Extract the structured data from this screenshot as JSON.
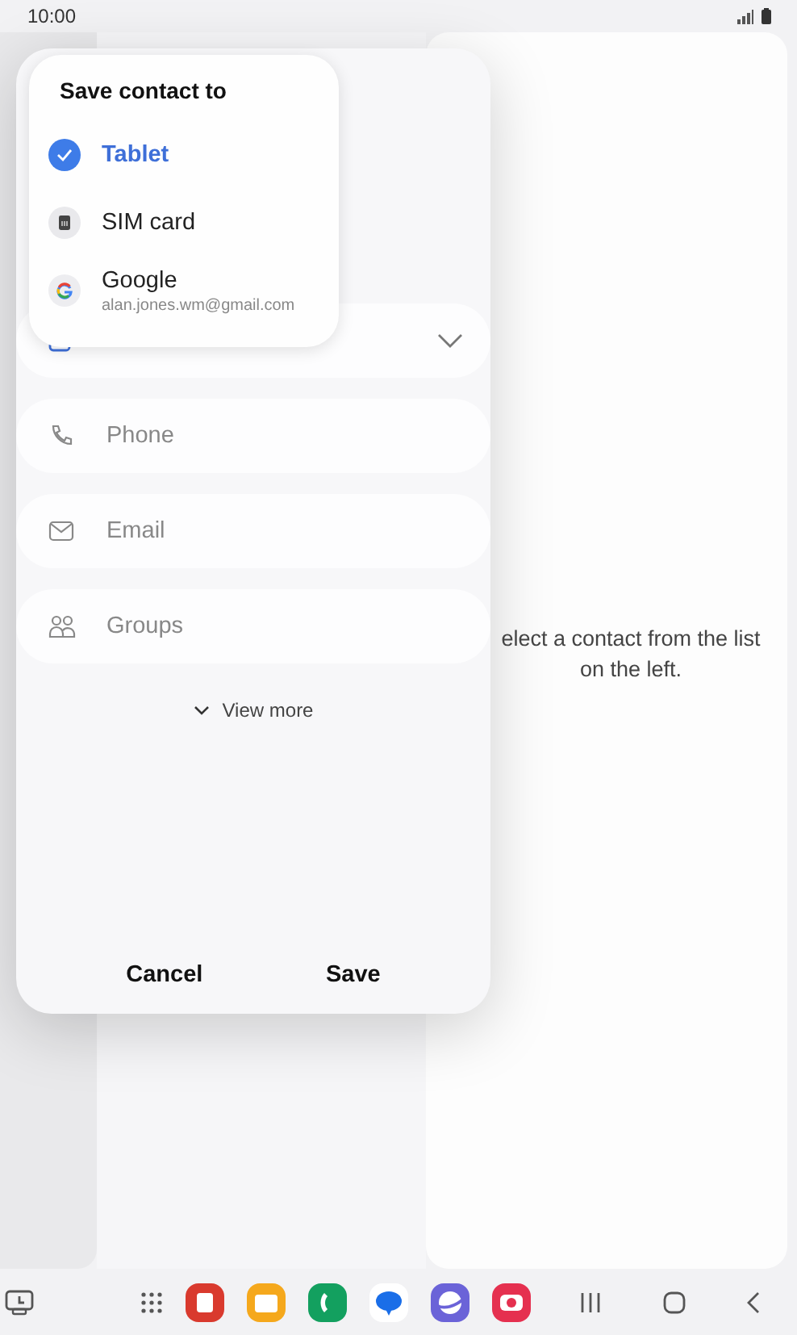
{
  "status_bar": {
    "time": "10:00"
  },
  "detail_pane": {
    "message": "elect a contact from the list on the left."
  },
  "dialog": {
    "fields": [
      {
        "kind": "name"
      },
      {
        "kind": "phone",
        "placeholder": "Phone"
      },
      {
        "kind": "email",
        "placeholder": "Email"
      },
      {
        "kind": "groups",
        "placeholder": "Groups"
      }
    ],
    "view_more": "View more",
    "buttons": [
      "Cancel",
      "Save"
    ]
  },
  "popup": {
    "title": "Save contact to",
    "options": [
      {
        "kind": "tablet",
        "label": "Tablet",
        "selected": true
      },
      {
        "kind": "sim",
        "label": "SIM card",
        "selected": false
      },
      {
        "kind": "google",
        "label": "Google",
        "account": "alan.jones.wm@gmail.com",
        "selected": false
      }
    ]
  },
  "taskbar": {
    "apps": [
      {
        "kind": "grid"
      },
      {
        "kind": "notes",
        "color": "#d93a2e"
      },
      {
        "kind": "files",
        "color": "#f5a81c"
      },
      {
        "kind": "phone",
        "color": "#13a05f"
      },
      {
        "kind": "messages",
        "color": "#ffffff"
      },
      {
        "kind": "internet",
        "color": "#6b63d8"
      },
      {
        "kind": "camera",
        "color": "#e5304f"
      }
    ]
  }
}
